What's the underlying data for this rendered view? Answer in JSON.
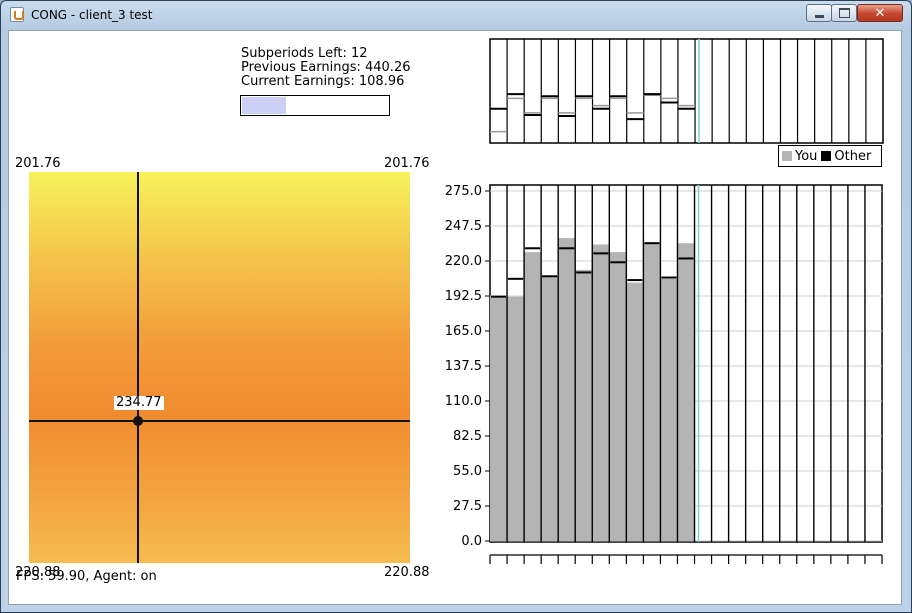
{
  "window": {
    "title": "CONG - client_3 test",
    "controls": {
      "minimize": "minimize",
      "maximize": "maximize",
      "close": "close"
    }
  },
  "info": {
    "subperiods_left": "Subperiods Left: 12",
    "previous_earnings": "Previous Earnings: 440.26",
    "current_earnings": "Current Earnings: 108.96",
    "progress_fraction": 0.3
  },
  "heatmap": {
    "top_left": "201.76",
    "top_right": "201.76",
    "bottom_left": "220.88",
    "bottom_right": "220.88",
    "point_label": "234.77"
  },
  "status": {
    "text": "FPS: 59.90, Agent: on"
  },
  "legend": {
    "you": "You",
    "other": "Other",
    "you_color": "#b4b4b4",
    "other_color": "#000000"
  },
  "colors": {
    "cursor_line": "#6fd6d2"
  },
  "chart_data": [
    {
      "type": "bar",
      "title": "",
      "xlabel": "",
      "ylabel": "",
      "ylim": [
        0,
        275
      ],
      "yticks": [
        "275.0",
        "247.5",
        "220.0",
        "192.5",
        "165.0",
        "137.5",
        "110.0",
        "82.5",
        "55.0",
        "27.5",
        "0.0"
      ],
      "total_subperiods": 23,
      "current_subperiod": 12,
      "series": [
        {
          "name": "You",
          "values": [
            192,
            192,
            227,
            208,
            238,
            213,
            233,
            227,
            203,
            234,
            206,
            234
          ]
        },
        {
          "name": "Other",
          "values": [
            192,
            206,
            230,
            208,
            230,
            211,
            226,
            219,
            205,
            234,
            207,
            222
          ]
        }
      ]
    },
    {
      "type": "line",
      "title": "",
      "xlabel": "",
      "ylabel": "",
      "note_strip": "upper mini strip",
      "series": [
        {
          "name": "You",
          "values": [
            0.1,
            0.42,
            0.28,
            0.42,
            0.28,
            0.42,
            0.35,
            0.42,
            0.28,
            0.45,
            0.42,
            0.35
          ]
        },
        {
          "name": "Other",
          "values": [
            0.32,
            0.46,
            0.26,
            0.44,
            0.25,
            0.44,
            0.32,
            0.44,
            0.22,
            0.46,
            0.38,
            0.32
          ]
        }
      ]
    }
  ]
}
